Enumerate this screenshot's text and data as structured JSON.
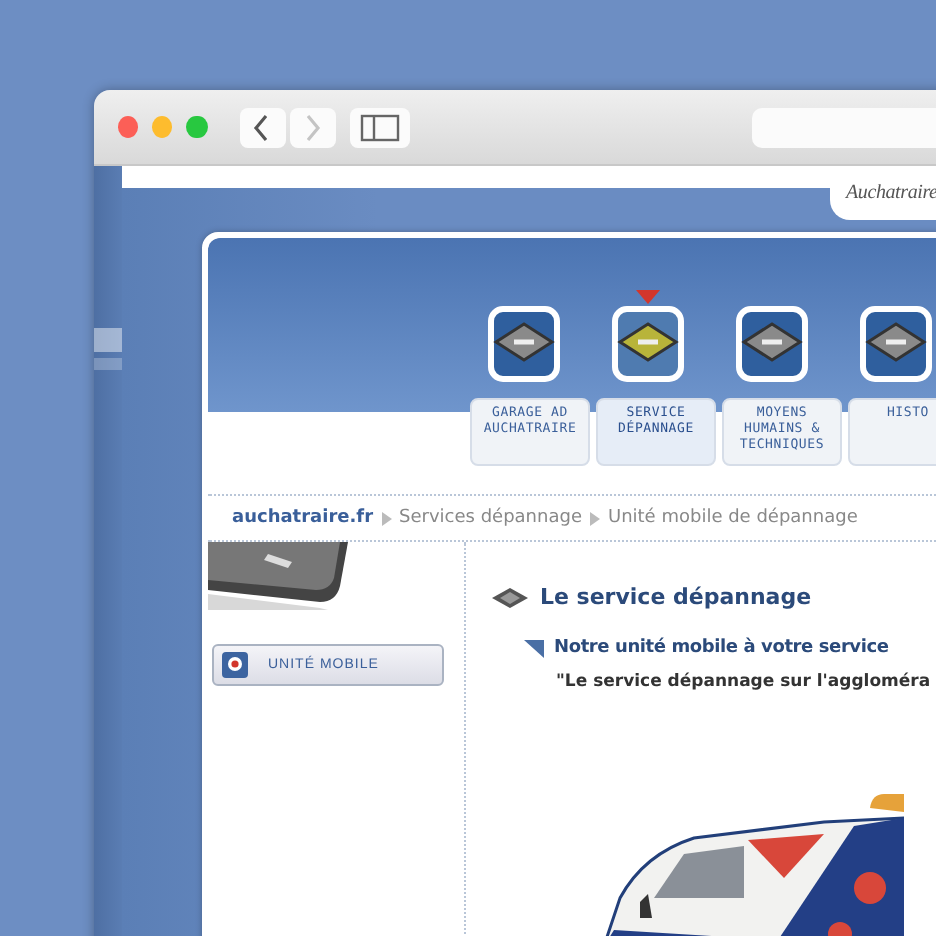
{
  "browser": {
    "nav_buttons": [
      {
        "kind": "back",
        "disabled": false
      },
      {
        "kind": "forward",
        "disabled": true
      }
    ]
  },
  "site": {
    "logo": "Auchatraire",
    "tabs": [
      {
        "label": "GARAGE AD AUCHATRAIRE",
        "selected": false
      },
      {
        "label": "SERVICE DÉPANNAGE",
        "selected": true
      },
      {
        "label": "MOYENS HUMAINS & TECHNIQUES",
        "selected": false
      },
      {
        "label": "HISTO",
        "selected": false
      }
    ],
    "breadcrumb": [
      "auchatraire.fr",
      "Services dépannage",
      "Unité mobile de dépannage"
    ],
    "sidebar": {
      "items": [
        {
          "label": "UNITÉ MOBILE",
          "selected": true
        }
      ]
    },
    "content": {
      "heading": "Le service dépannage",
      "subheading": "Notre unité mobile à votre service",
      "quote": "\"Le service dépannage sur l'aggloméra"
    }
  }
}
